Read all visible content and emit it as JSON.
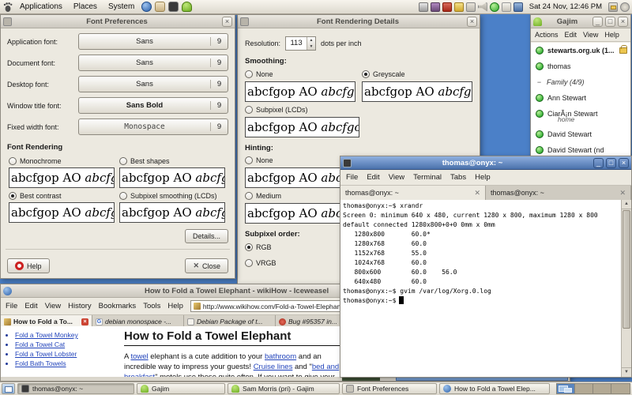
{
  "panel": {
    "menus": [
      {
        "label": "Applications"
      },
      {
        "label": "Places"
      },
      {
        "label": "System"
      }
    ],
    "clock": "Sat 24 Nov, 12:46 PM"
  },
  "font_prefs": {
    "title": "Font Preferences",
    "rows": [
      {
        "label": "Application font:",
        "font": "Sans",
        "size": "9"
      },
      {
        "label": "Document font:",
        "font": "Sans",
        "size": "9"
      },
      {
        "label": "Desktop font:",
        "font": "Sans",
        "size": "9"
      },
      {
        "label": "Window title font:",
        "font": "Sans Bold",
        "size": "9"
      },
      {
        "label": "Fixed width font:",
        "font": "Monospace",
        "size": "9"
      }
    ],
    "section_title": "Font Rendering",
    "options": [
      {
        "label": "Monochrome",
        "selected": false
      },
      {
        "label": "Best shapes",
        "selected": false
      },
      {
        "label": "Best contrast",
        "selected": true
      },
      {
        "label": "Subpixel smoothing (LCDs)",
        "selected": false
      }
    ],
    "sample_roman": "abcfgop AO ",
    "sample_italic": "abcfgop",
    "details_button": "Details...",
    "help_button": "Help",
    "close_button": "Close"
  },
  "font_details": {
    "title": "Font Rendering Details",
    "resolution_label": "Resolution:",
    "resolution_value": "113",
    "resolution_unit": "dots per inch",
    "smoothing_title": "Smoothing:",
    "smoothing_options": [
      {
        "label": "None",
        "selected": false
      },
      {
        "label": "Greyscale",
        "selected": true
      },
      {
        "label": "Subpixel (LCDs)",
        "selected": false
      }
    ],
    "hinting_title": "Hinting:",
    "hinting_options": [
      {
        "label": "None",
        "selected": false
      },
      {
        "label": "Medium",
        "selected": false
      }
    ],
    "subpixel_title": "Subpixel order:",
    "subpixel_options": [
      {
        "label": "RGB",
        "selected": true
      },
      {
        "label": "VRGB",
        "selected": false
      }
    ],
    "sample_roman": "abcfgop AO ",
    "sample_italic": "abcfgop"
  },
  "gajim": {
    "title": "Gajim",
    "menus": [
      "Actions",
      "Edit",
      "View",
      "Help"
    ],
    "account": "stewarts.org.uk (1...",
    "group": "Family (4/9)",
    "contacts": [
      "thomas",
      "Ann Stewart",
      "CiarÃ¡n Stewart",
      "David Stewart",
      "David Stewart (nd"
    ],
    "contact_sub": "home"
  },
  "chat_sliver": {
    "text": "Sam Morris (pri)"
  },
  "terminal": {
    "title": "thomas@onyx: ~",
    "menus": [
      "File",
      "Edit",
      "View",
      "Terminal",
      "Tabs",
      "Help"
    ],
    "tabs": [
      "thomas@onyx: ~",
      "thomas@onyx: ~"
    ],
    "lines": [
      "thomas@onyx:~$ xrandr",
      "Screen 0: minimum 640 x 480, current 1280 x 800, maximum 1280 x 800",
      "default connected 1280x800+0+0 0mm x 0mm",
      "   1280x800       60.0*",
      "   1280x768       60.0",
      "   1152x768       55.0",
      "   1024x768       60.0",
      "   800x600        60.0    56.0",
      "   640x480        60.0",
      "thomas@onyx:~$ gvim /var/log/Xorg.0.log",
      "thomas@onyx:~$"
    ]
  },
  "browser": {
    "title": "How to Fold a Towel Elephant - wikiHow - Iceweasel",
    "menus": [
      "File",
      "Edit",
      "View",
      "History",
      "Bookmarks",
      "Tools",
      "Help"
    ],
    "url": "http://www.wikihow.com/Fold-a-Towel-Elephant",
    "tabs": [
      "How to Fold a To...",
      "debian monospace -...",
      "Debian Package of t...",
      "Bug #95357 in..."
    ],
    "sidebar_links": [
      "Fold a Towel Monkey",
      "Fold a Towel Cat",
      "Fold a Towel Lobster",
      "Fold Bath Towels"
    ],
    "heading": "How to Fold a Towel Elephant",
    "para": {
      "s0": "A ",
      "l0": "towel",
      "s1": " elephant is a cute addition to your ",
      "l1": "bathroom",
      "s2": " and an incredible way to impress your guests! ",
      "l2": "Cruise lines",
      "s3": " and \"",
      "l3": "bed and breakfast",
      "s4": "\" motels use these quite often. If you want to give your"
    }
  },
  "taskbar": {
    "buttons": [
      "thomas@onyx: ~",
      "Gajim",
      "Sam Morris (pri) - Gajim",
      "Font Preferences",
      "How to Fold a Towel Elep..."
    ]
  }
}
